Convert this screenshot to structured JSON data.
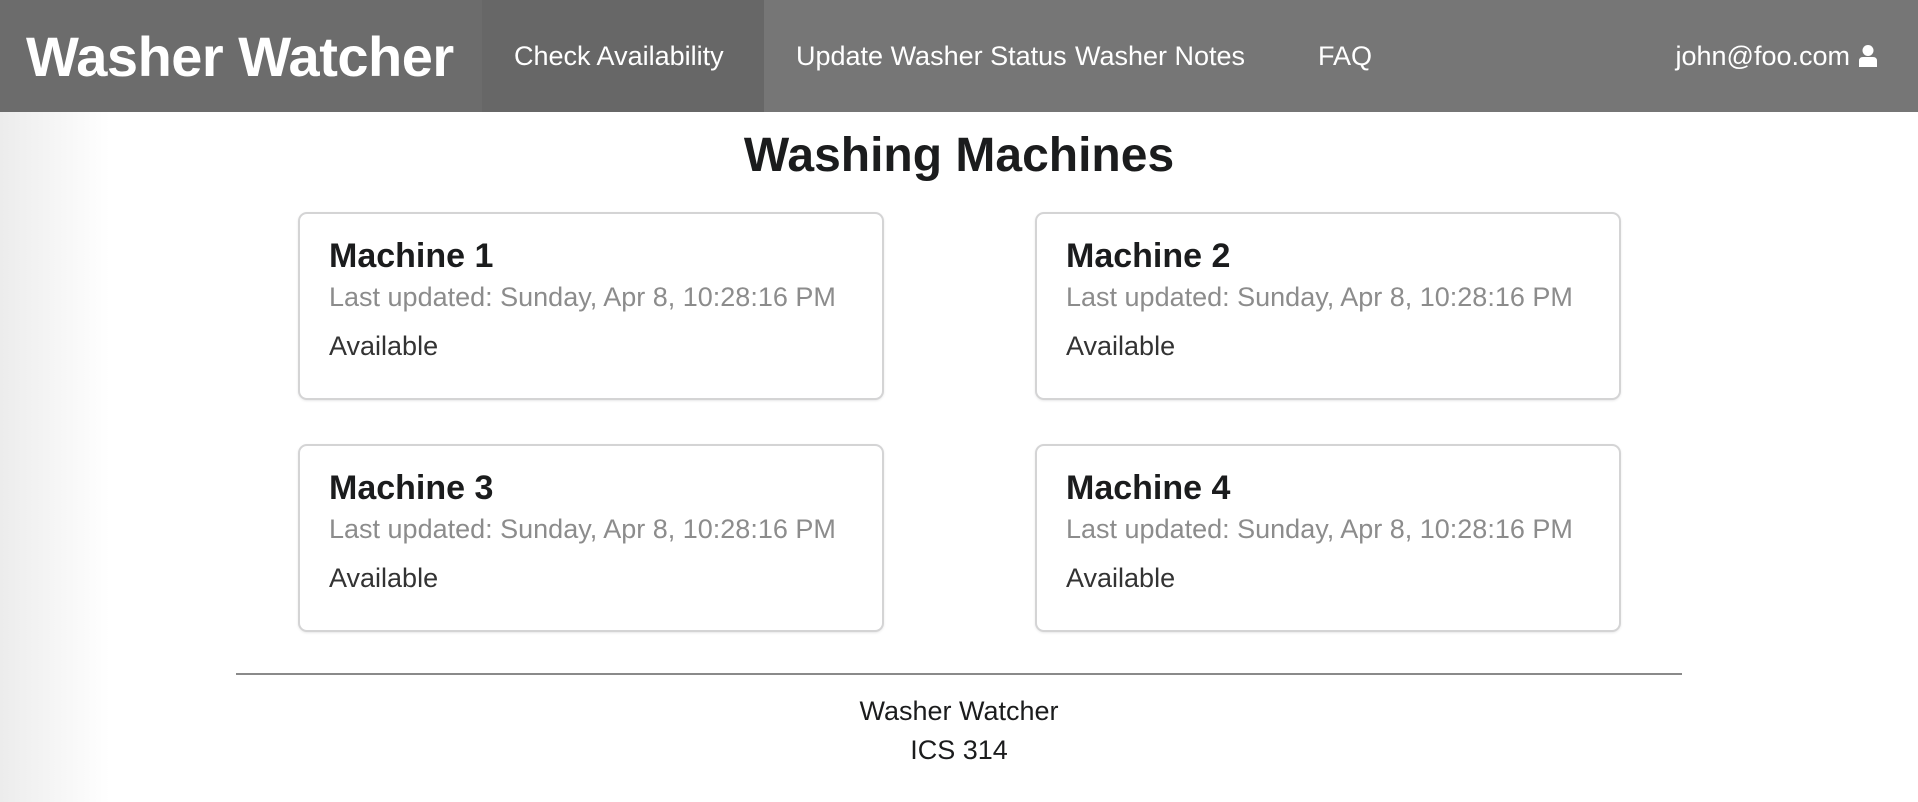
{
  "navbar": {
    "brand": "Washer Watcher",
    "items": [
      {
        "label": "Check Availability",
        "active": true
      },
      {
        "label": "Update Washer Status",
        "active": false
      },
      {
        "label": "Washer Notes",
        "active": false
      },
      {
        "label": "FAQ",
        "active": false
      }
    ],
    "user": {
      "email": "john@foo.com",
      "icon": "user-icon"
    },
    "colors": {
      "background": "#767676",
      "brand_background": "#6c6c6c",
      "active_background": "#676767",
      "text": "#ffffff"
    }
  },
  "main": {
    "title": "Washing Machines",
    "machines": [
      {
        "name": "Machine 1",
        "last_updated": "Last updated: Sunday, Apr 8, 10:28:16 PM",
        "status": "Available"
      },
      {
        "name": "Machine 2",
        "last_updated": "Last updated: Sunday, Apr 8, 10:28:16 PM",
        "status": "Available"
      },
      {
        "name": "Machine 3",
        "last_updated": "Last updated: Sunday, Apr 8, 10:28:16 PM",
        "status": "Available"
      },
      {
        "name": "Machine 4",
        "last_updated": "Last updated: Sunday, Apr 8, 10:28:16 PM",
        "status": "Available"
      }
    ]
  },
  "footer": {
    "line1": "Washer Watcher",
    "line2": "ICS 314"
  }
}
